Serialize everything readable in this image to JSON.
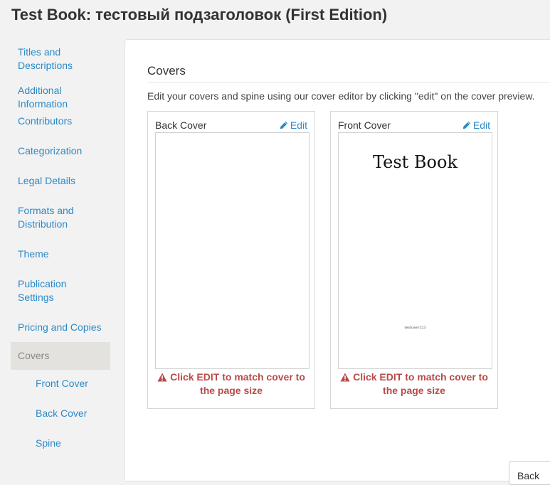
{
  "page": {
    "title": "Test Book: тестовый подзаголовок (First Edition)"
  },
  "sidebar": {
    "items": [
      {
        "label": "Titles and Descriptions"
      },
      {
        "label": "Additional Information"
      },
      {
        "label": "Contributors"
      },
      {
        "label": "Categorization"
      },
      {
        "label": "Legal Details"
      },
      {
        "label": "Formats and Distribution"
      },
      {
        "label": "Theme"
      },
      {
        "label": "Publication Settings"
      },
      {
        "label": "Pricing and Copies"
      },
      {
        "label": "Covers",
        "active": true
      },
      {
        "label": "Front Cover"
      },
      {
        "label": "Back Cover"
      },
      {
        "label": "Spine"
      }
    ]
  },
  "covers": {
    "heading": "Covers",
    "intro": "Edit your covers and spine using our cover editor by clicking \"edit\" on the cover preview.",
    "back": {
      "label": "Back Cover",
      "edit_label": "Edit",
      "warning": "Click EDIT to match cover to the page size"
    },
    "front": {
      "label": "Front Cover",
      "edit_label": "Edit",
      "book_title": "Test Book",
      "book_author": "testuser123",
      "warning": "Click EDIT to match cover to the page size"
    }
  },
  "footer": {
    "back_button": "Back"
  },
  "colors": {
    "link": "#2a8ac9",
    "warning": "#b94a48",
    "active_nav_bg": "#e3e2df"
  },
  "icons": {
    "edit": "pencil-icon",
    "warning": "warning-triangle-icon"
  }
}
